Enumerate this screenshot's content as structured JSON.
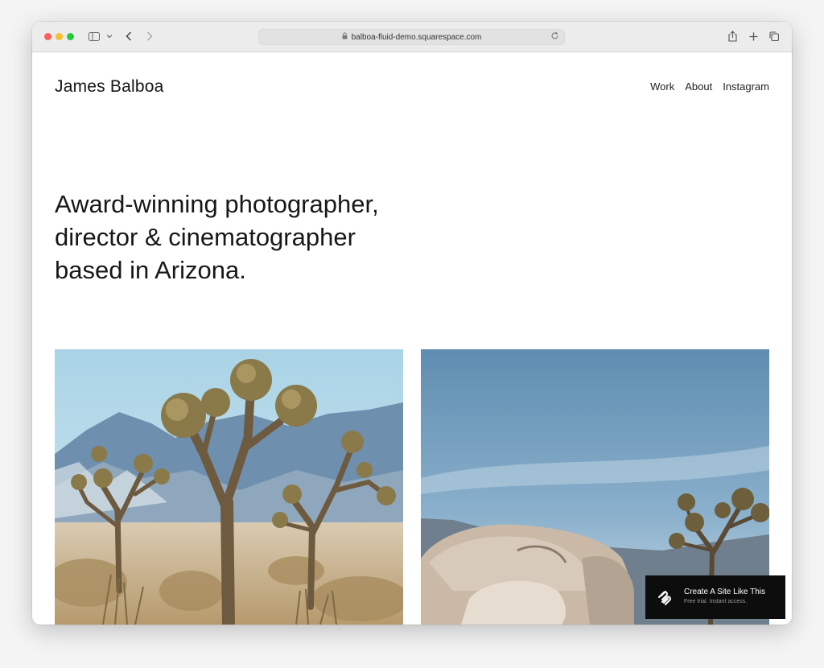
{
  "browser": {
    "url": "balboa-fluid-demo.squarespace.com",
    "icons": [
      "sidebar-toggle-icon",
      "chevron-down-icon",
      "back-icon",
      "forward-icon",
      "lock-icon",
      "reload-icon",
      "share-icon",
      "new-tab-icon",
      "tabs-overview-icon"
    ]
  },
  "site": {
    "logo": "James Balboa",
    "nav": [
      "Work",
      "About",
      "Instagram"
    ],
    "hero": {
      "line1": "Award-winning photographer,",
      "line2": "director & cinematographer",
      "line3": "based in Arizona."
    }
  },
  "badge": {
    "title": "Create A Site Like This",
    "subtitle": "Free trial. Instant access."
  },
  "colors": {
    "window_bg": "#ffffff",
    "toolbar_bg": "#ececec",
    "text": "#171717",
    "badge_bg": "#0d0d0d",
    "sky_left": "#9fc8de",
    "sky_right": "#6f9ab8"
  }
}
